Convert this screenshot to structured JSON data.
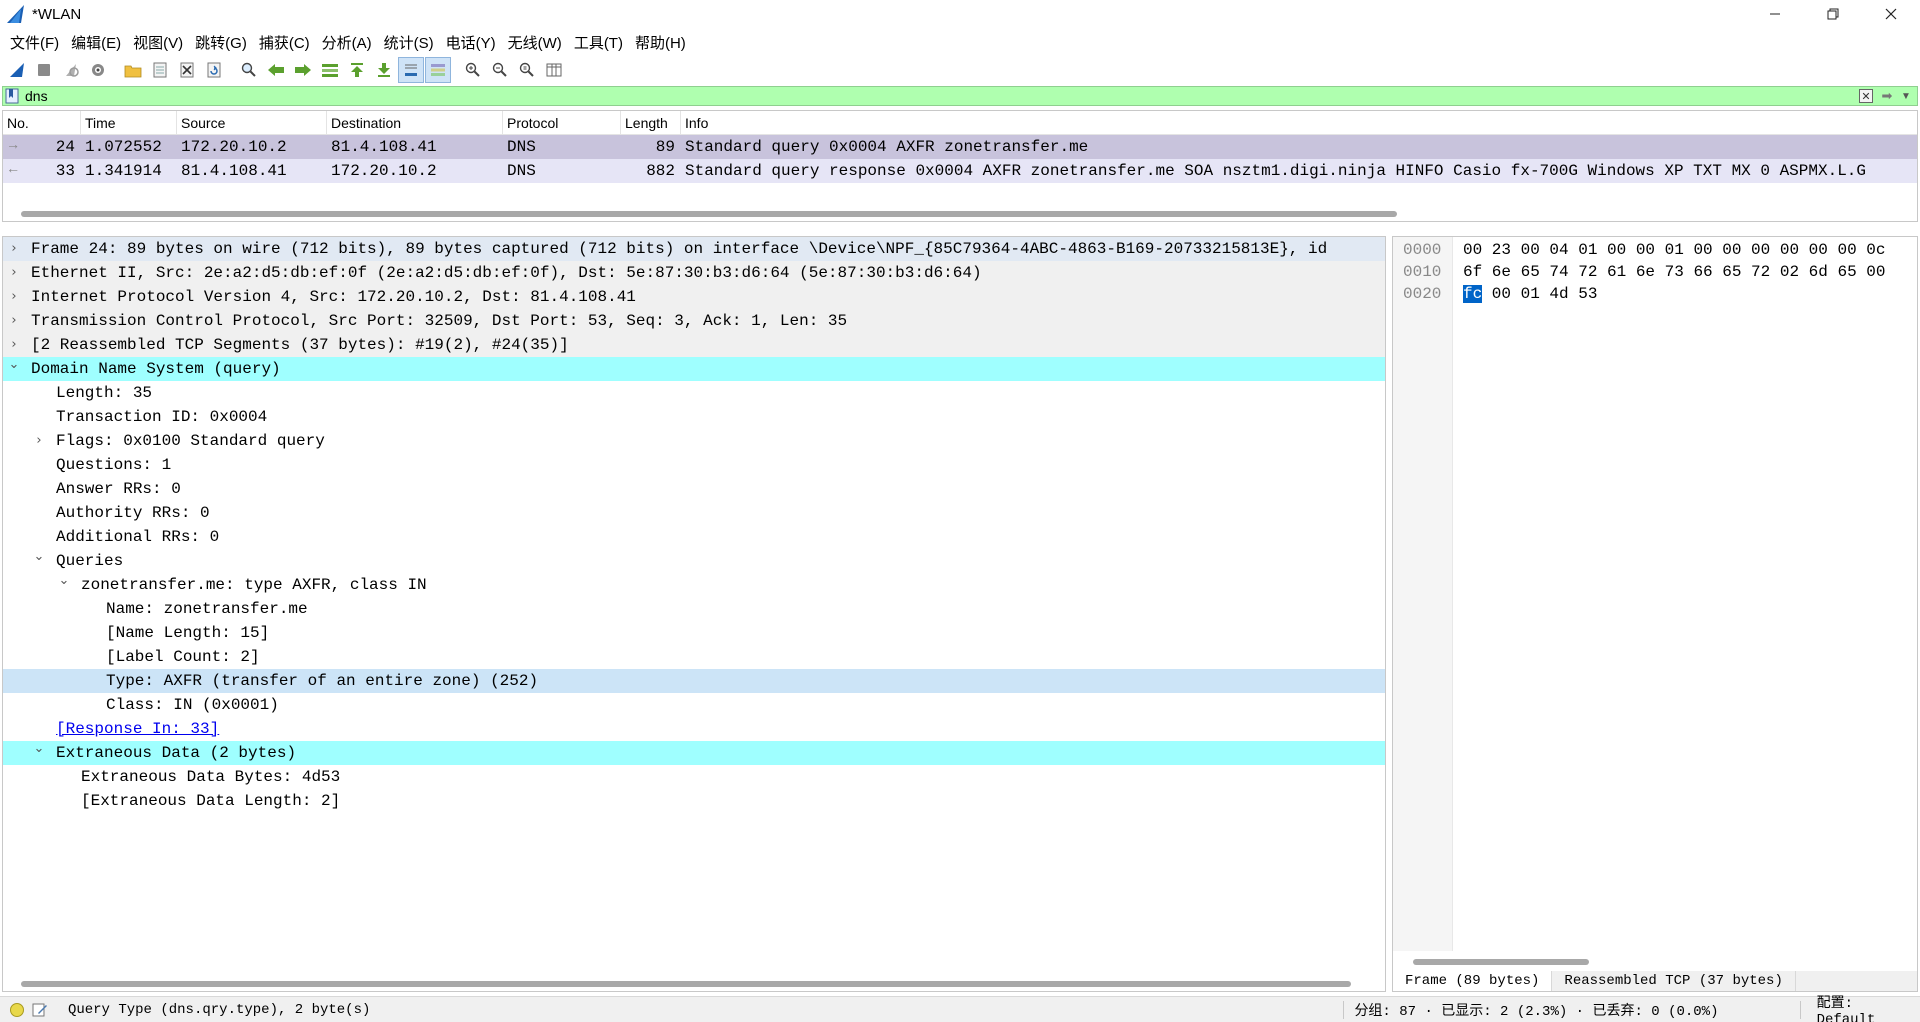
{
  "window": {
    "title": "*WLAN",
    "minimize_icon": "minimize-icon",
    "restore_icon": "restore-icon",
    "close_icon": "close-icon"
  },
  "menu": [
    {
      "label": "文件(F)"
    },
    {
      "label": "编辑(E)"
    },
    {
      "label": "视图(V)"
    },
    {
      "label": "跳转(G)"
    },
    {
      "label": "捕获(C)"
    },
    {
      "label": "分析(A)"
    },
    {
      "label": "统计(S)"
    },
    {
      "label": "电话(Y)"
    },
    {
      "label": "无线(W)"
    },
    {
      "label": "工具(T)"
    },
    {
      "label": "帮助(H)"
    }
  ],
  "toolbar": {
    "icons": [
      "start-capture-icon",
      "stop-capture-icon",
      "restart-capture-icon",
      "capture-options-icon",
      "open-file-icon",
      "save-file-icon",
      "close-file-icon",
      "reload-file-icon",
      "find-packet-icon",
      "go-back-icon",
      "go-forward-icon",
      "go-to-packet-icon",
      "go-first-icon",
      "go-last-icon",
      "auto-scroll-icon",
      "colorize-icon",
      "zoom-in-icon",
      "zoom-out-icon",
      "zoom-normal-icon",
      "resize-columns-icon"
    ]
  },
  "filter": {
    "value": "dns"
  },
  "packet_list": {
    "columns": [
      "No.",
      "Time",
      "Source",
      "Destination",
      "Protocol",
      "Length",
      "Info"
    ],
    "rows": [
      {
        "no": "24",
        "time": "1.072552",
        "source": "172.20.10.2",
        "destination": "81.4.108.41",
        "protocol": "DNS",
        "length": "89",
        "info": "Standard query 0x0004 AXFR zonetransfer.me"
      },
      {
        "no": "33",
        "time": "1.341914",
        "source": "81.4.108.41",
        "destination": "172.20.10.2",
        "protocol": "DNS",
        "length": "882",
        "info": "Standard query response 0x0004 AXFR zonetransfer.me SOA nsztm1.digi.ninja HINFO Casio fx-700G Windows XP TXT MX 0 ASPMX.L.G"
      }
    ]
  },
  "details": {
    "tree": [
      {
        "text": "Frame 24: 89 bytes on wire (712 bits), 89 bytes captured (712 bits) on interface \\Device\\NPF_{85C79364-4ABC-4863-B169-20733215813E}, id",
        "level": 0,
        "toggle": "collapsed"
      },
      {
        "text": "Ethernet II, Src: 2e:a2:d5:db:ef:0f (2e:a2:d5:db:ef:0f), Dst: 5e:87:30:b3:d6:64 (5e:87:30:b3:d6:64)",
        "level": 0,
        "toggle": "collapsed"
      },
      {
        "text": "Internet Protocol Version 4, Src: 172.20.10.2, Dst: 81.4.108.41",
        "level": 0,
        "toggle": "collapsed"
      },
      {
        "text": "Transmission Control Protocol, Src Port: 32509, Dst Port: 53, Seq: 3, Ack: 1, Len: 35",
        "level": 0,
        "toggle": "collapsed"
      },
      {
        "text": "[2 Reassembled TCP Segments (37 bytes): #19(2), #24(35)]",
        "level": 0,
        "toggle": "collapsed"
      },
      {
        "text": "Domain Name System (query)",
        "level": 0,
        "toggle": "expanded"
      },
      {
        "text": "Length: 35",
        "level": 1,
        "toggle": "none"
      },
      {
        "text": "Transaction ID: 0x0004",
        "level": 1,
        "toggle": "none"
      },
      {
        "text": "Flags: 0x0100 Standard query",
        "level": 1,
        "toggle": "collapsed"
      },
      {
        "text": "Questions: 1",
        "level": 1,
        "toggle": "none"
      },
      {
        "text": "Answer RRs: 0",
        "level": 1,
        "toggle": "none"
      },
      {
        "text": "Authority RRs: 0",
        "level": 1,
        "toggle": "none"
      },
      {
        "text": "Additional RRs: 0",
        "level": 1,
        "toggle": "none"
      },
      {
        "text": "Queries",
        "level": 1,
        "toggle": "expanded"
      },
      {
        "text": "zonetransfer.me: type AXFR, class IN",
        "level": 2,
        "toggle": "expanded"
      },
      {
        "text": "Name: zonetransfer.me",
        "level": 3,
        "toggle": "none"
      },
      {
        "text": "[Name Length: 15]",
        "level": 3,
        "toggle": "none"
      },
      {
        "text": "[Label Count: 2]",
        "level": 3,
        "toggle": "none"
      },
      {
        "text": "Type: AXFR (transfer of an entire zone) (252)",
        "level": 3,
        "toggle": "none"
      },
      {
        "text": "Class: IN (0x0001)",
        "level": 3,
        "toggle": "none"
      },
      {
        "text": "[Response In: 33]",
        "level": 1,
        "toggle": "none"
      },
      {
        "text": "Extraneous Data (2 bytes)",
        "level": 1,
        "toggle": "expanded"
      },
      {
        "text": "Extraneous Data Bytes: 4d53",
        "level": 2,
        "toggle": "none"
      },
      {
        "text": "[Extraneous Data Length: 2]",
        "level": 2,
        "toggle": "none"
      }
    ]
  },
  "bytes": {
    "rows": [
      {
        "offset": "0000",
        "hex": "00 23 00 04 01 00 00 01  00 00 00 00 00 00 0c"
      },
      {
        "offset": "0010",
        "hex": "6f 6e 65 74 72 61 6e 73  66 65 72 02 6d 65 00"
      },
      {
        "offset": "0020",
        "hex_selected": "fc",
        "hex": " 00 01 4d 53"
      }
    ],
    "tabs": [
      "Frame (89 bytes)",
      "Reassembled TCP (37 bytes)"
    ]
  },
  "status": {
    "field_text": "Query Type (dns.qry.type), 2 byte(s)",
    "stats_text": "分组: 87 · 已显示: 2 (2.3%) · 已丢弃: 0 (0.0%)",
    "profile_text": "配置: Default"
  }
}
